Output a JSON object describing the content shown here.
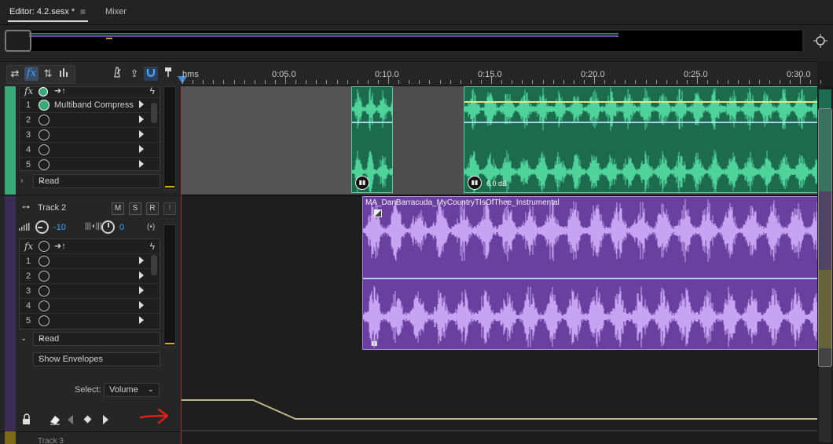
{
  "tabs": {
    "editor": "Editor: 4.2.sesx *",
    "mixer": "Mixer",
    "menu_glyph": "≡"
  },
  "ruler": {
    "labels": [
      "hms",
      "0:05.0",
      "0:10.0",
      "0:15.0",
      "0:20.0",
      "0:25.0",
      "0:30.0"
    ]
  },
  "tracks": {
    "track1": {
      "fx_rows": [
        {
          "num": "1",
          "name": "Multiband Compress",
          "on": true
        },
        {
          "num": "2",
          "name": "",
          "on": false
        },
        {
          "num": "3",
          "name": "",
          "on": false
        },
        {
          "num": "4",
          "name": "",
          "on": false
        },
        {
          "num": "5",
          "name": "",
          "on": false
        }
      ],
      "read_mode": "Read",
      "clip_gain": "6.0 dB",
      "color": "#3aa878"
    },
    "track2": {
      "name": "Track 2",
      "btn_m": "M",
      "btn_s": "S",
      "btn_r": "R",
      "btn_i": "I",
      "volume": "-10",
      "pan": "0",
      "fx_rows": [
        {
          "num": "1",
          "name": ""
        },
        {
          "num": "2",
          "name": ""
        },
        {
          "num": "3",
          "name": ""
        },
        {
          "num": "4",
          "name": ""
        },
        {
          "num": "5",
          "name": ""
        }
      ],
      "read_mode": "Read",
      "show_envelopes": "Show Envelopes",
      "select_label": "Select:",
      "select_value": "Volume",
      "clip_title": "MA_DanBarracuda_MyCountryTIsOfThee_Instrumental",
      "color": "#6a3fa0"
    },
    "track3": {
      "name": "Track 3",
      "color": "#7a6a18"
    }
  },
  "colors": {
    "accent": "#3a8dde",
    "green_clip": "#1c6b4f",
    "green_wave": "#4fd39b",
    "purple_clip": "#6a3fa0",
    "purple_wave": "#c7a4f2",
    "annotation_arrow": "#e0201a",
    "envelope": "#b9b98a"
  }
}
